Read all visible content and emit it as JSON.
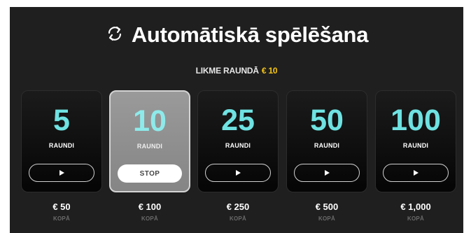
{
  "header": {
    "title": "Automātiskā spēlēšana",
    "icon": "autoplay-repeat-icon"
  },
  "bet": {
    "label": "LIKME RAUNDĀ",
    "amount": "€ 10",
    "amount_color": "#f5c518"
  },
  "options": [
    {
      "rounds": "5",
      "unit": "RAUNDI",
      "action": "play",
      "total": "€ 50",
      "total_label": "KOPĀ",
      "active": false
    },
    {
      "rounds": "10",
      "unit": "RAUNDI",
      "action": "STOP",
      "total": "€ 100",
      "total_label": "KOPĀ",
      "active": true
    },
    {
      "rounds": "25",
      "unit": "RAUNDI",
      "action": "play",
      "total": "€ 250",
      "total_label": "KOPĀ",
      "active": false
    },
    {
      "rounds": "50",
      "unit": "RAUNDI",
      "action": "play",
      "total": "€ 500",
      "total_label": "KOPĀ",
      "active": false
    },
    {
      "rounds": "100",
      "unit": "RAUNDI",
      "action": "play",
      "total": "€ 1,000",
      "total_label": "KOPĀ",
      "active": false
    }
  ],
  "colors": {
    "background": "#1f1f1f",
    "rounds_number": "#6fe2e2"
  }
}
